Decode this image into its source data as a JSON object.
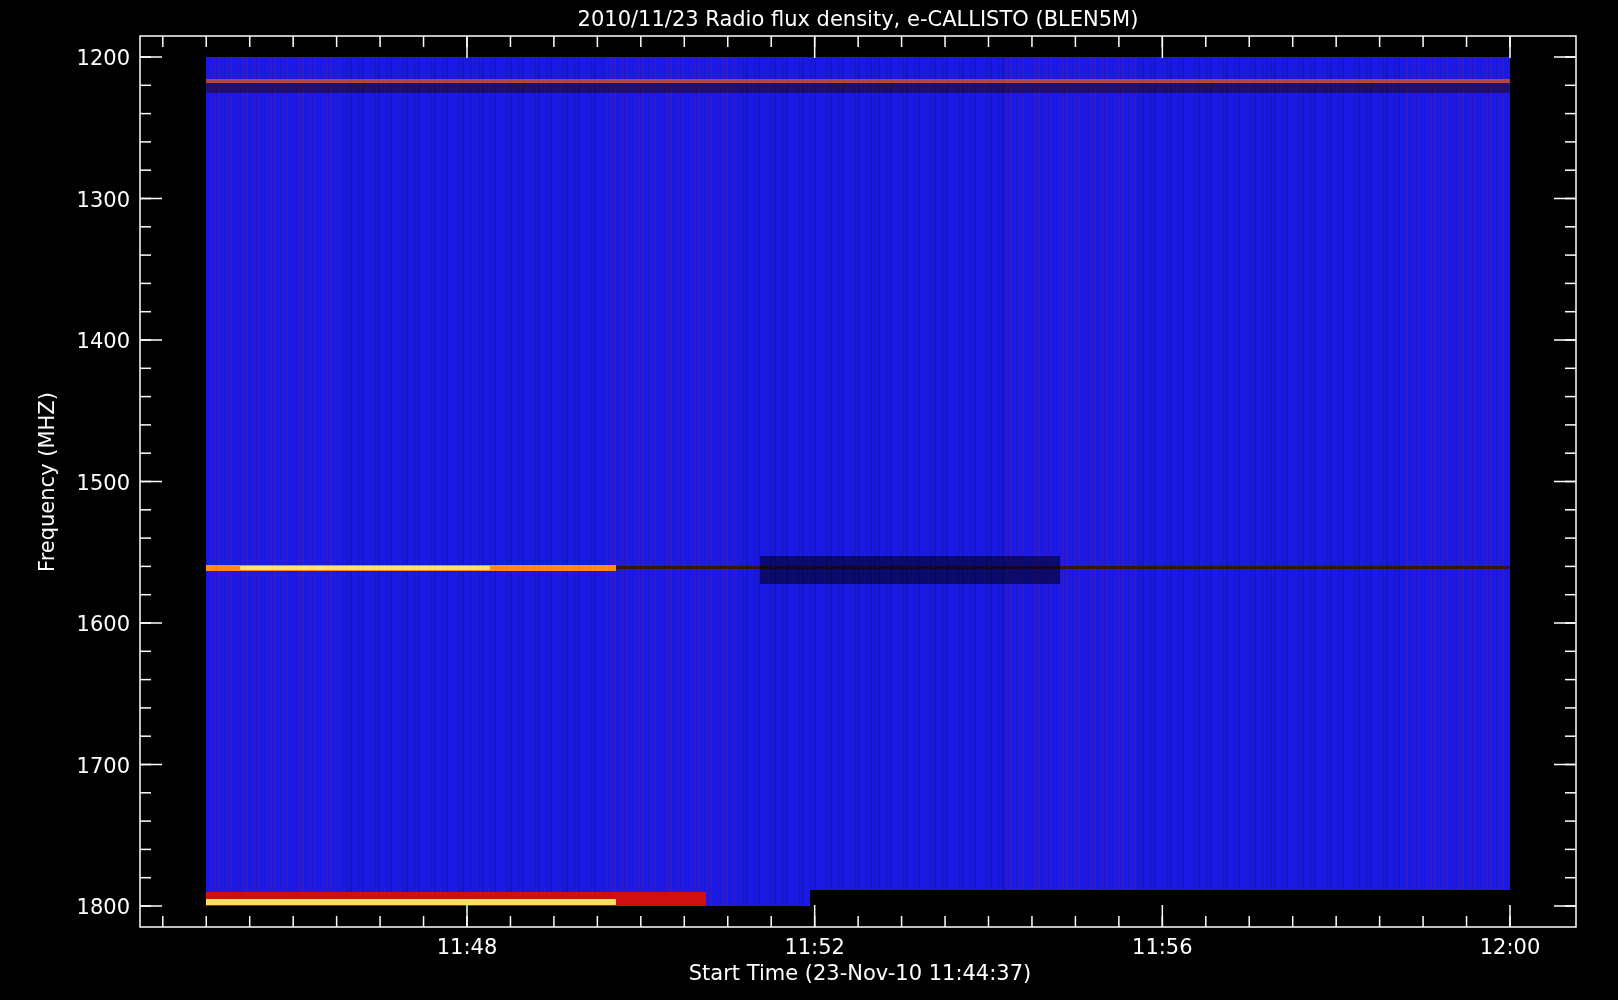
{
  "title": "2010/11/23  Radio flux density, e-CALLISTO (BLEN5M)",
  "y_axis": {
    "label": "Frequency (MHZ)",
    "ticks": [
      "1200",
      "1300",
      "1400",
      "1500",
      "1600",
      "1700",
      "1800"
    ]
  },
  "x_axis": {
    "label": "Start Time (23-Nov-10 11:44:37)",
    "ticks": [
      "11:48",
      "11:52",
      "11:56",
      "12:00"
    ]
  }
}
